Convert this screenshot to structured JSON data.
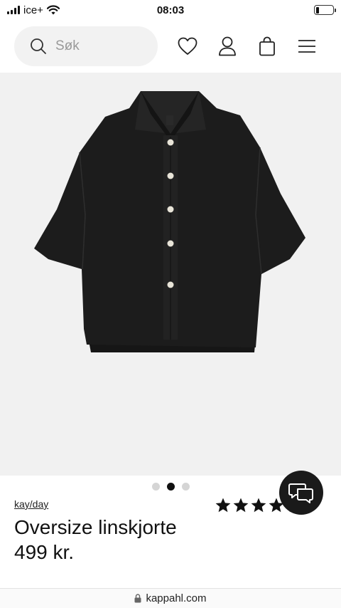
{
  "status_bar": {
    "carrier": "ice+",
    "time": "08:03",
    "battery_level": 0.2
  },
  "header": {
    "search_placeholder": "Søk",
    "icons": [
      "search-icon",
      "heart-icon",
      "user-icon",
      "shopping-bag-icon",
      "menu-icon"
    ]
  },
  "product": {
    "image_alt": "black oversized linen shirt",
    "image_count": 3,
    "active_image": 2,
    "brand": "kay/day",
    "name": "Oversize linskjorte",
    "price": "499 kr.",
    "rating": 5
  },
  "chat": {
    "icon": "chat-bubbles-icon"
  },
  "browser": {
    "url": "kappahl.com",
    "icon": "lock-icon"
  },
  "colors": {
    "image_bg": "#f1f1f1",
    "shirt": "#1c1c1c",
    "accent": "#111111"
  }
}
